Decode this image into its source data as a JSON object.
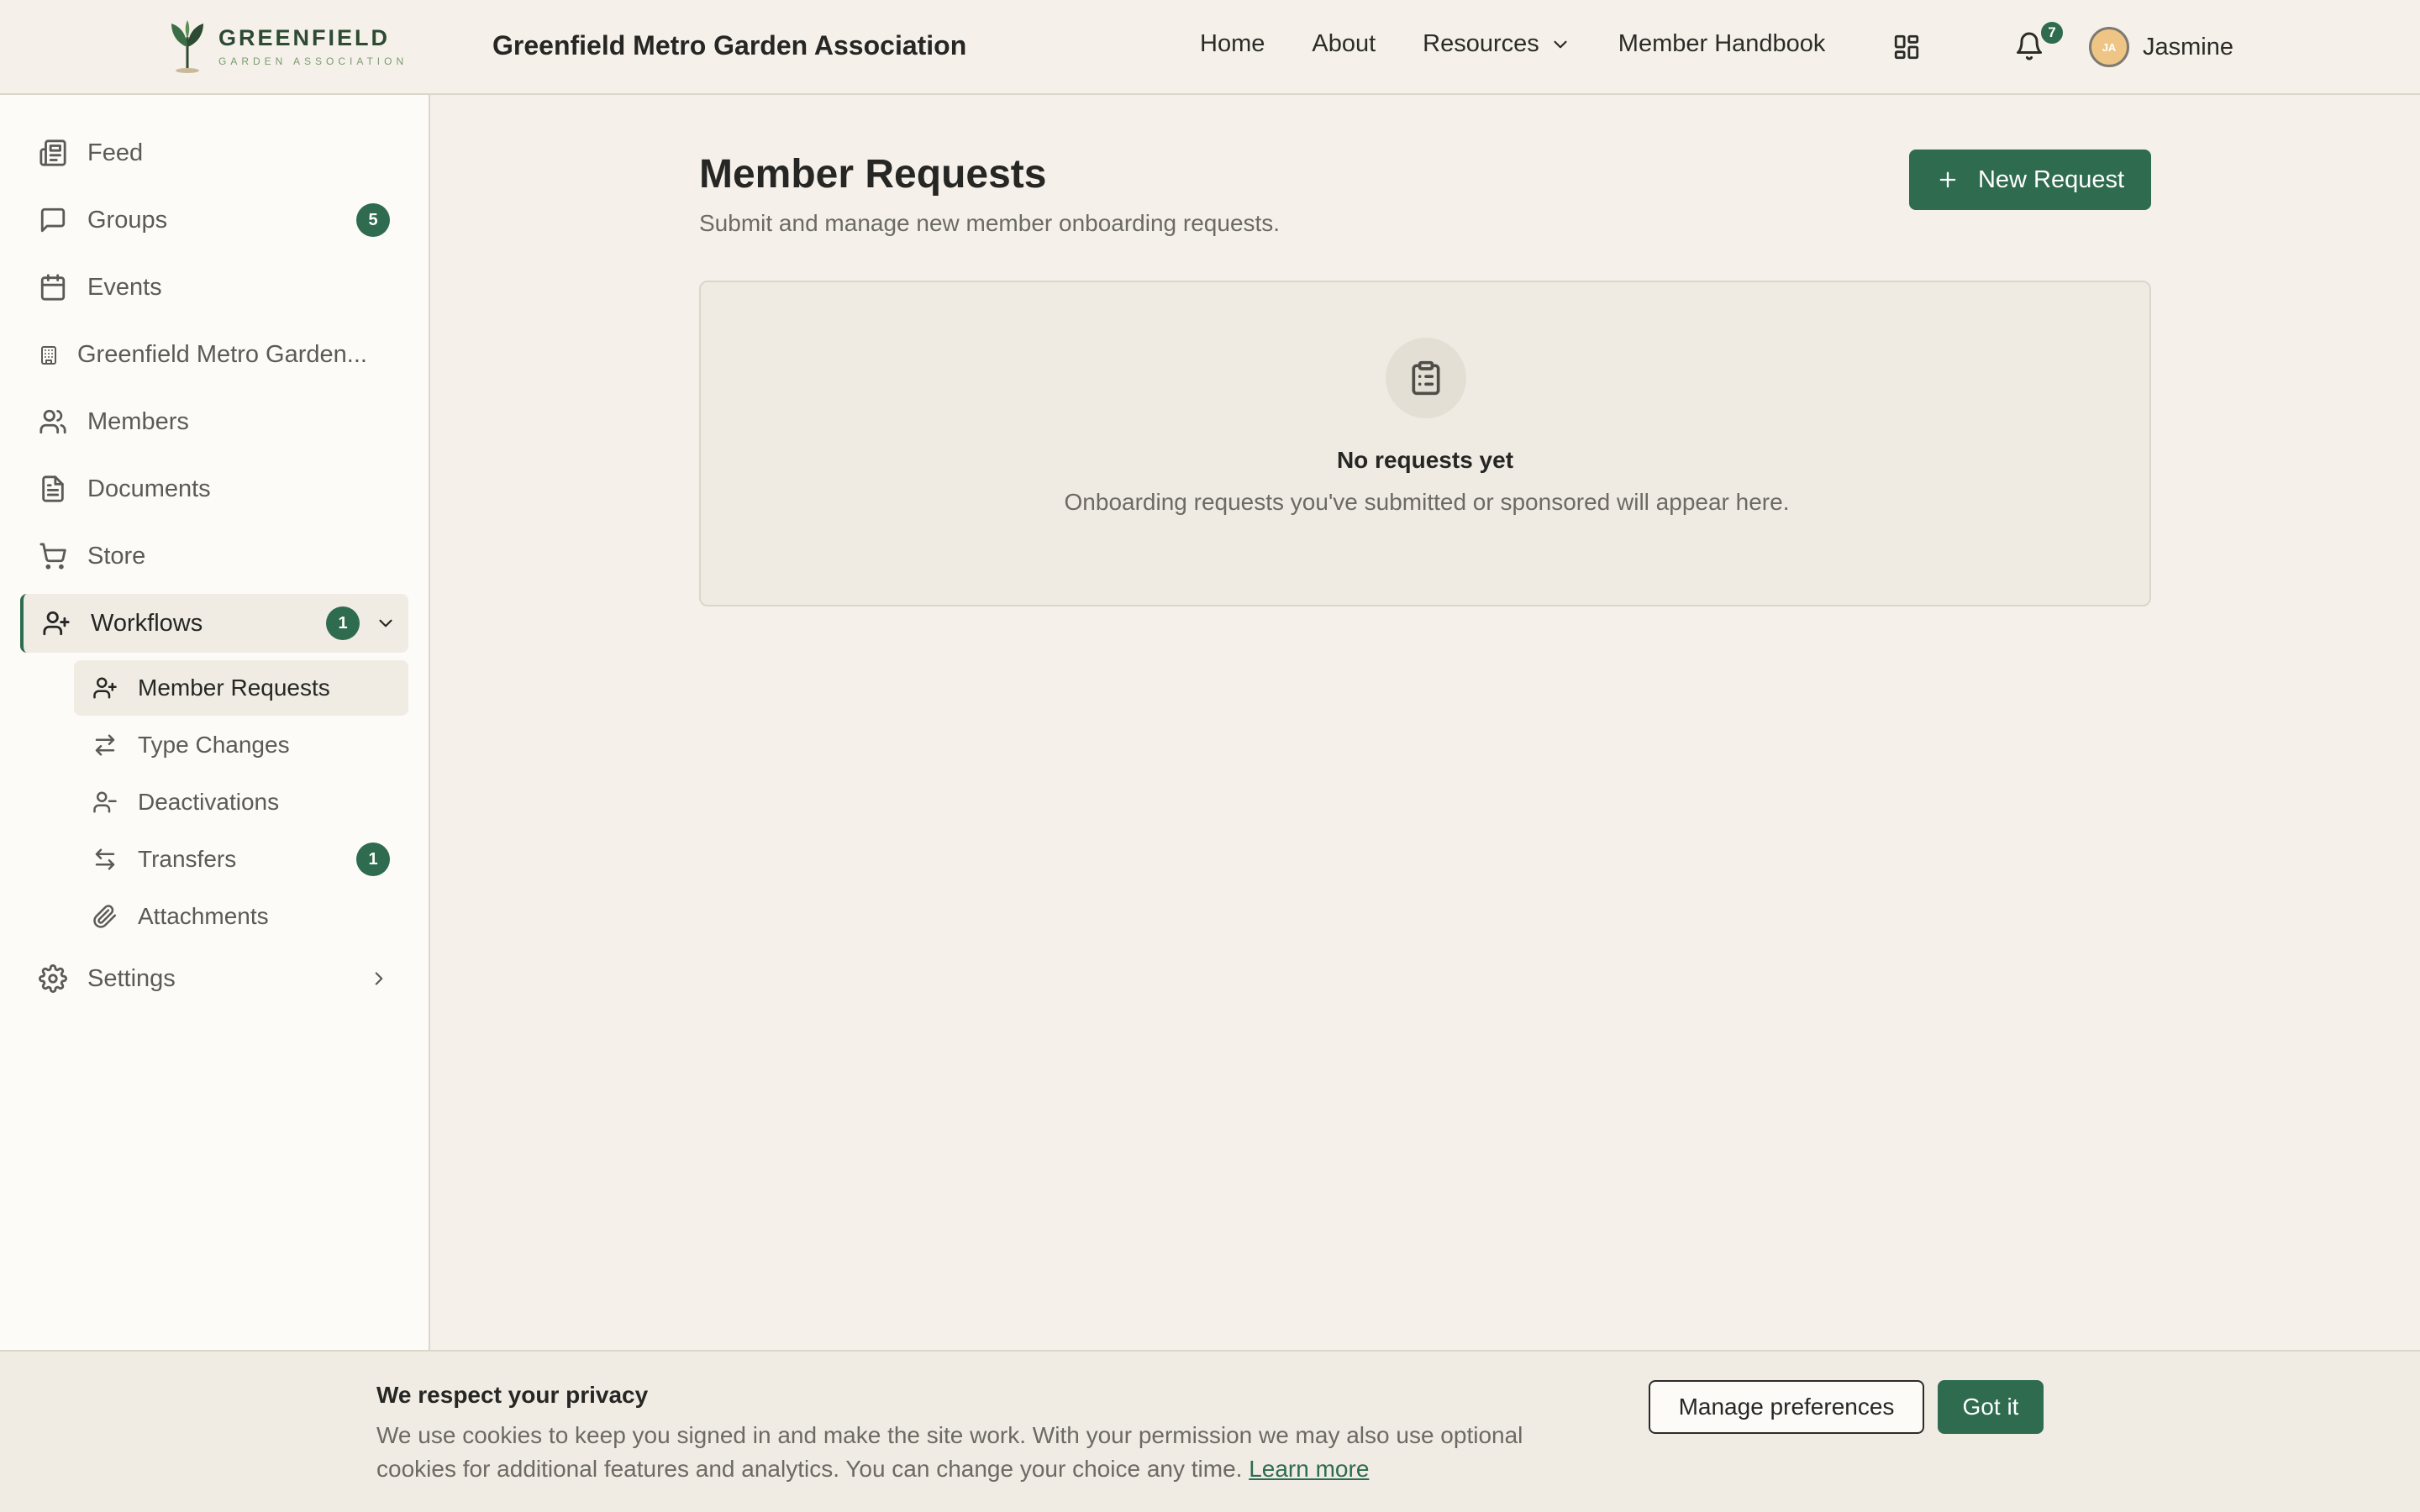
{
  "header": {
    "logo_name": "GREENFIELD",
    "logo_sub": "GARDEN ASSOCIATION",
    "title": "Greenfield Metro Garden Association",
    "nav": [
      {
        "label": "Home"
      },
      {
        "label": "About"
      },
      {
        "label": "Resources",
        "icon": "chevron-down-icon"
      },
      {
        "label": "Member Handbook"
      }
    ],
    "apps_icon": "grid-icon",
    "notifications_count": "7",
    "user": {
      "initials": "JA",
      "name": "Jasmine"
    }
  },
  "sidebar": {
    "items": [
      {
        "label": "Feed",
        "icon": "newspaper-icon"
      },
      {
        "label": "Groups",
        "icon": "message-square-icon",
        "badge": "5"
      },
      {
        "label": "Events",
        "icon": "calendar-icon"
      },
      {
        "label": "Greenfield Metro Garden...",
        "icon": "building-icon"
      },
      {
        "label": "Members",
        "icon": "users-icon"
      },
      {
        "label": "Documents",
        "icon": "file-text-icon"
      },
      {
        "label": "Store",
        "icon": "shopping-cart-icon"
      },
      {
        "label": "Workflows",
        "icon": "user-plus-icon",
        "badge": "1",
        "expanded": true
      },
      {
        "label": "Settings",
        "icon": "gear-icon"
      }
    ],
    "workflows": [
      {
        "label": "Member Requests",
        "icon": "user-plus-icon",
        "selected": true
      },
      {
        "label": "Type Changes",
        "icon": "arrows-swap-icon"
      },
      {
        "label": "Deactivations",
        "icon": "user-minus-icon"
      },
      {
        "label": "Transfers",
        "icon": "arrows-transfer-icon",
        "badge": "1"
      },
      {
        "label": "Attachments",
        "icon": "paperclip-icon"
      }
    ]
  },
  "main": {
    "title": "Member Requests",
    "subtitle": "Submit and manage new member onboarding requests.",
    "new_button": "New Request",
    "empty": {
      "icon": "clipboard-icon",
      "title": "No requests yet",
      "description": "Onboarding requests you've submitted or sponsored will appear here."
    }
  },
  "cookie": {
    "title": "We respect your privacy",
    "text": "We use cookies to keep you signed in and make the site work. With your permission we may also use optional cookies for additional features and analytics. You can change your choice any time.",
    "link": "Learn more",
    "manage_button": "Manage preferences",
    "accept_button": "Got it"
  },
  "colors": {
    "accent": "#2e6b4f",
    "background": "#f5f1ea",
    "sidebar": "#fcfbf8"
  }
}
